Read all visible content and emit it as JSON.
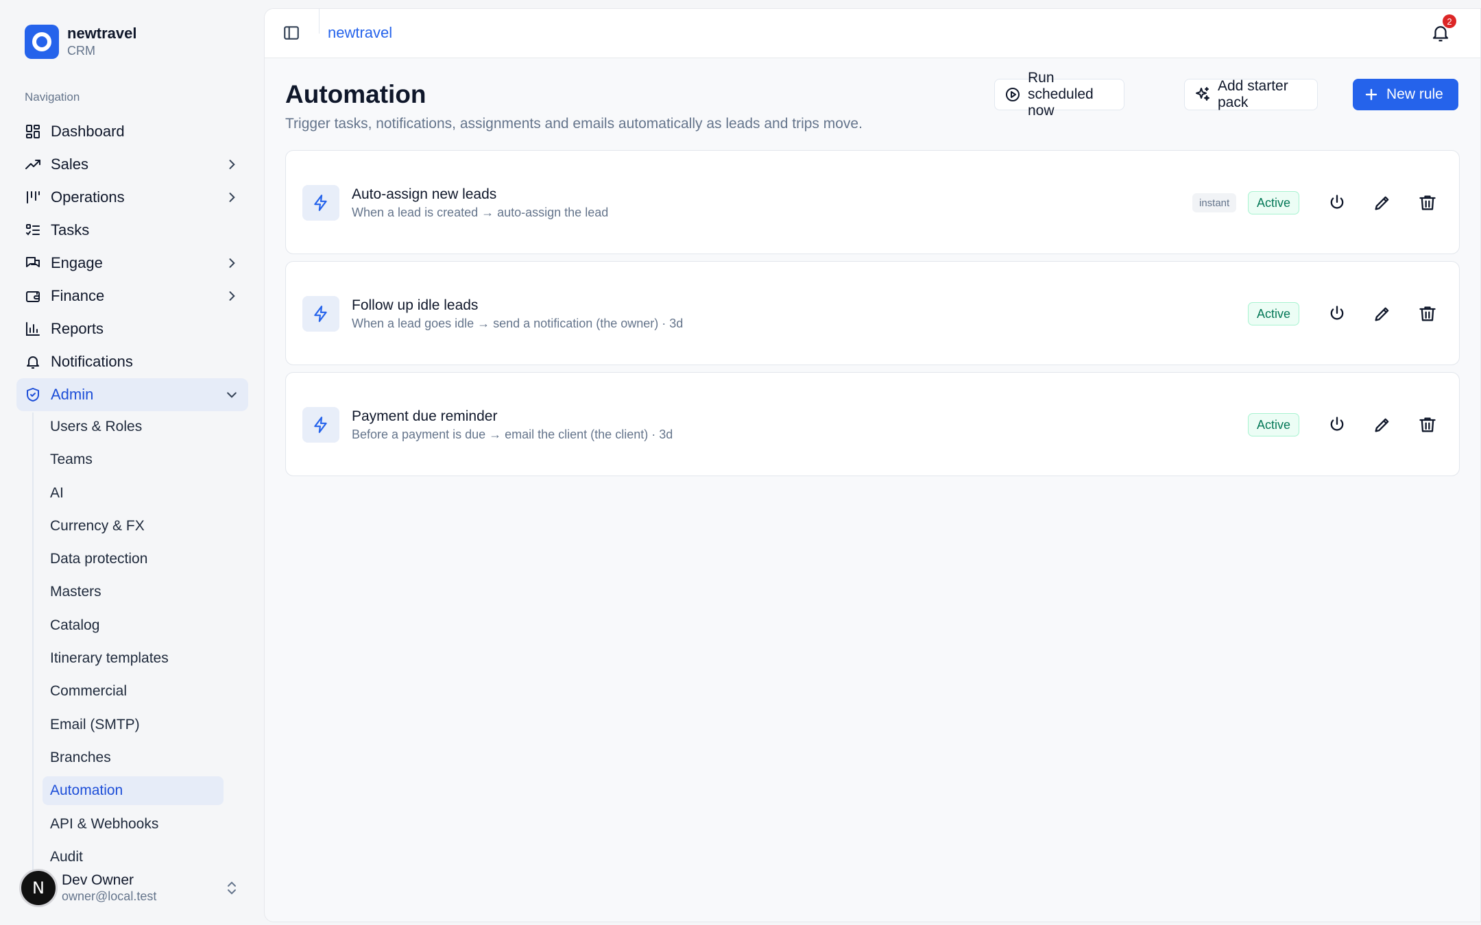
{
  "brand": {
    "name": "newtravel",
    "sub": "CRM"
  },
  "sidebar": {
    "section_label": "Navigation",
    "items": [
      {
        "label": "Dashboard",
        "icon": "dashboard-icon",
        "chevron": false
      },
      {
        "label": "Sales",
        "icon": "trending-up-icon",
        "chevron": true
      },
      {
        "label": "Operations",
        "icon": "columns-icon",
        "chevron": true
      },
      {
        "label": "Tasks",
        "icon": "checklist-icon",
        "chevron": false
      },
      {
        "label": "Engage",
        "icon": "chat-icon",
        "chevron": true
      },
      {
        "label": "Finance",
        "icon": "wallet-icon",
        "chevron": true
      },
      {
        "label": "Reports",
        "icon": "bar-chart-icon",
        "chevron": false
      },
      {
        "label": "Notifications",
        "icon": "bell-icon",
        "chevron": false
      },
      {
        "label": "Admin",
        "icon": "shield-icon",
        "chevron": true,
        "expanded": true,
        "active": true
      }
    ],
    "admin_items": [
      "Users & Roles",
      "Teams",
      "AI",
      "Currency & FX",
      "Data protection",
      "Masters",
      "Catalog",
      "Itinerary templates",
      "Commercial",
      "Email (SMTP)",
      "Branches",
      "Automation",
      "API & Webhooks",
      "Audit"
    ],
    "active_admin_item": "Automation"
  },
  "user": {
    "initial": "N",
    "name": "Dev Owner",
    "email": "owner@local.test"
  },
  "topbar": {
    "breadcrumb": "newtravel",
    "notification_count": "2"
  },
  "page": {
    "title": "Automation",
    "description": "Trigger tasks, notifications, assignments and emails automatically as leads and trips move.",
    "buttons": {
      "run_scheduled": "Run scheduled now",
      "starter_pack": "Add starter pack",
      "new_rule": "New rule"
    }
  },
  "rules": [
    {
      "name": "Auto-assign new leads",
      "desc": "When a lead is created → auto-assign the lead",
      "tag": "instant",
      "status": "Active"
    },
    {
      "name": "Follow up idle leads",
      "desc": "When a lead goes idle → send a notification (the owner) · 3d",
      "tag": "",
      "status": "Active"
    },
    {
      "name": "Payment due reminder",
      "desc": "Before a payment is due → email the client (the client) · 3d",
      "tag": "",
      "status": "Active"
    }
  ],
  "colors": {
    "accent": "#2563eb",
    "active_bg": "#e6ecf8",
    "status_green": "#047857",
    "badge_red": "#dc2626"
  }
}
